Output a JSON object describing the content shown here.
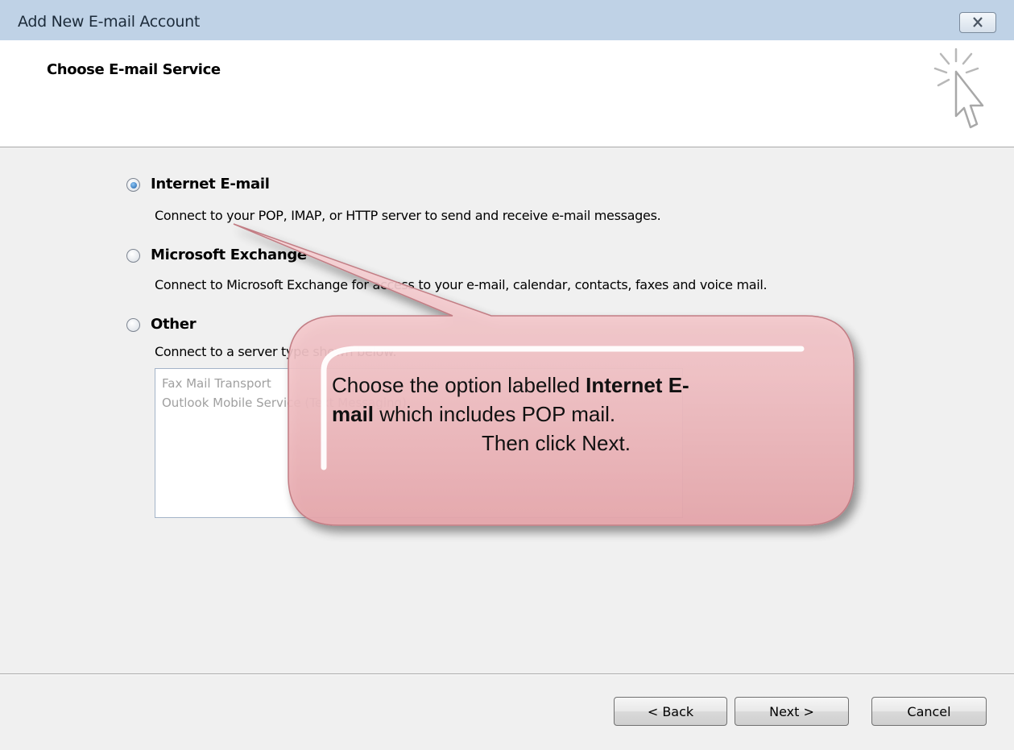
{
  "window": {
    "title": "Add New E-mail Account",
    "close_icon": "close-icon"
  },
  "header": {
    "title": "Choose E-mail Service",
    "wizard_icon": "sparkle-cursor-icon"
  },
  "options": [
    {
      "label": "Internet E-mail",
      "description": "Connect to your POP, IMAP, or HTTP server to send and receive e-mail messages.",
      "selected": true
    },
    {
      "label": "Microsoft Exchange",
      "description": "Connect to Microsoft Exchange for access to your e-mail, calendar, contacts, faxes and voice mail.",
      "selected": false
    },
    {
      "label": "Other",
      "description": "Connect to a server type shown below.",
      "selected": false
    }
  ],
  "other_list": {
    "items": [
      "Fax Mail Transport",
      "Outlook Mobile Service (Text Messaging)"
    ]
  },
  "buttons": {
    "back": "< Back",
    "next": "Next >",
    "cancel": "Cancel"
  },
  "callout": {
    "text_prefix": "Choose the option labelled ",
    "bold_1": "Internet E-",
    "bold_2": "mail",
    "text_suffix": " which includes POP mail.",
    "line2": "Then click Next.",
    "fill_color": "#f2c3c6"
  }
}
